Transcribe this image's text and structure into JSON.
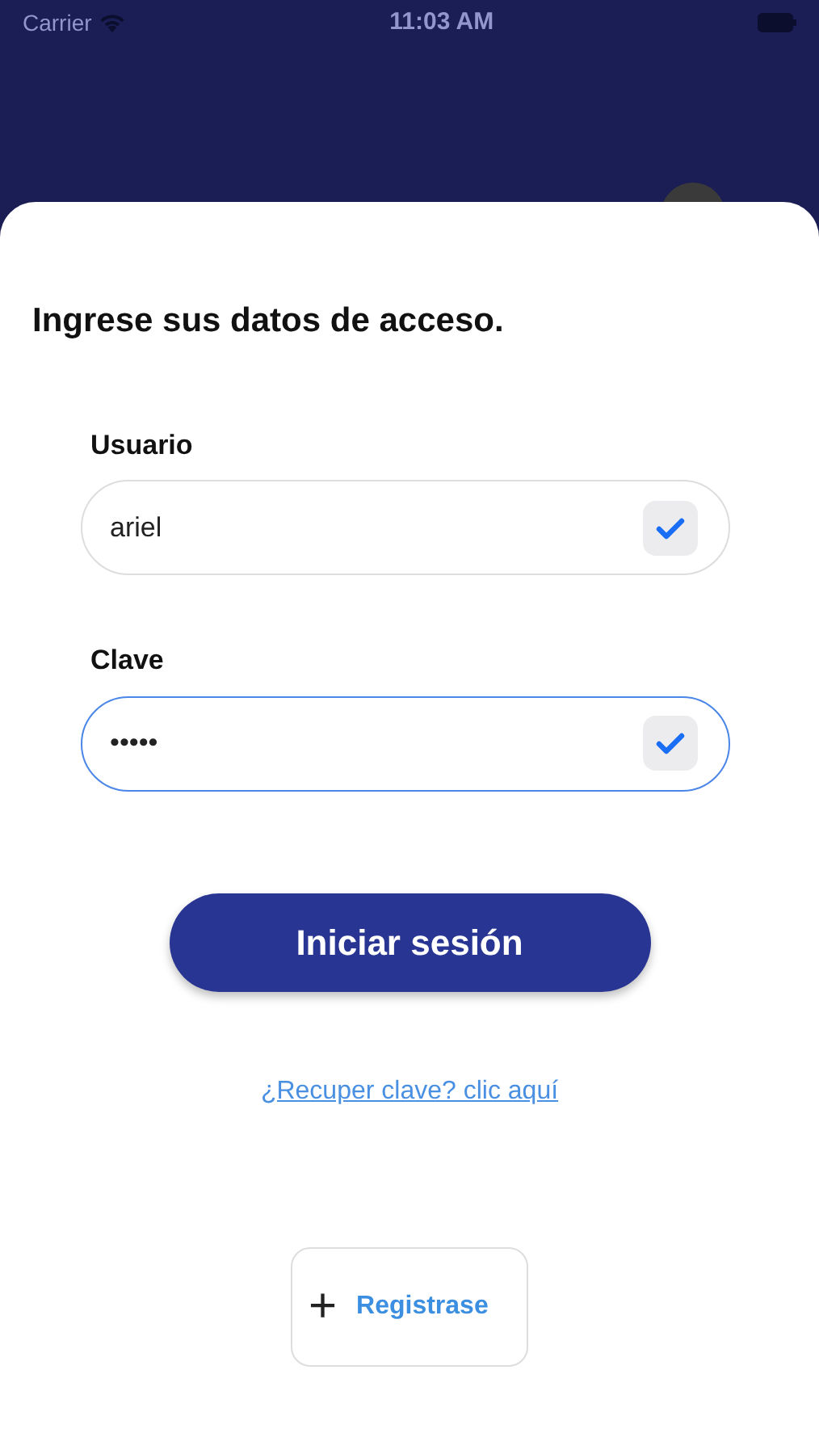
{
  "status_bar": {
    "carrier": "Carrier",
    "time": "11:03 AM"
  },
  "heading": "Ingrese sus datos de acceso.",
  "fields": [
    {
      "label": "Usuario",
      "value": "ariel",
      "focused": false,
      "valid": true
    },
    {
      "label": "Clave",
      "value": "•••••",
      "focused": true,
      "valid": true
    }
  ],
  "login_button": "Iniciar sesión",
  "recover_link": "¿Recuper clave? clic aquí",
  "register_button": {
    "icon": "+",
    "label": "Registrase"
  }
}
